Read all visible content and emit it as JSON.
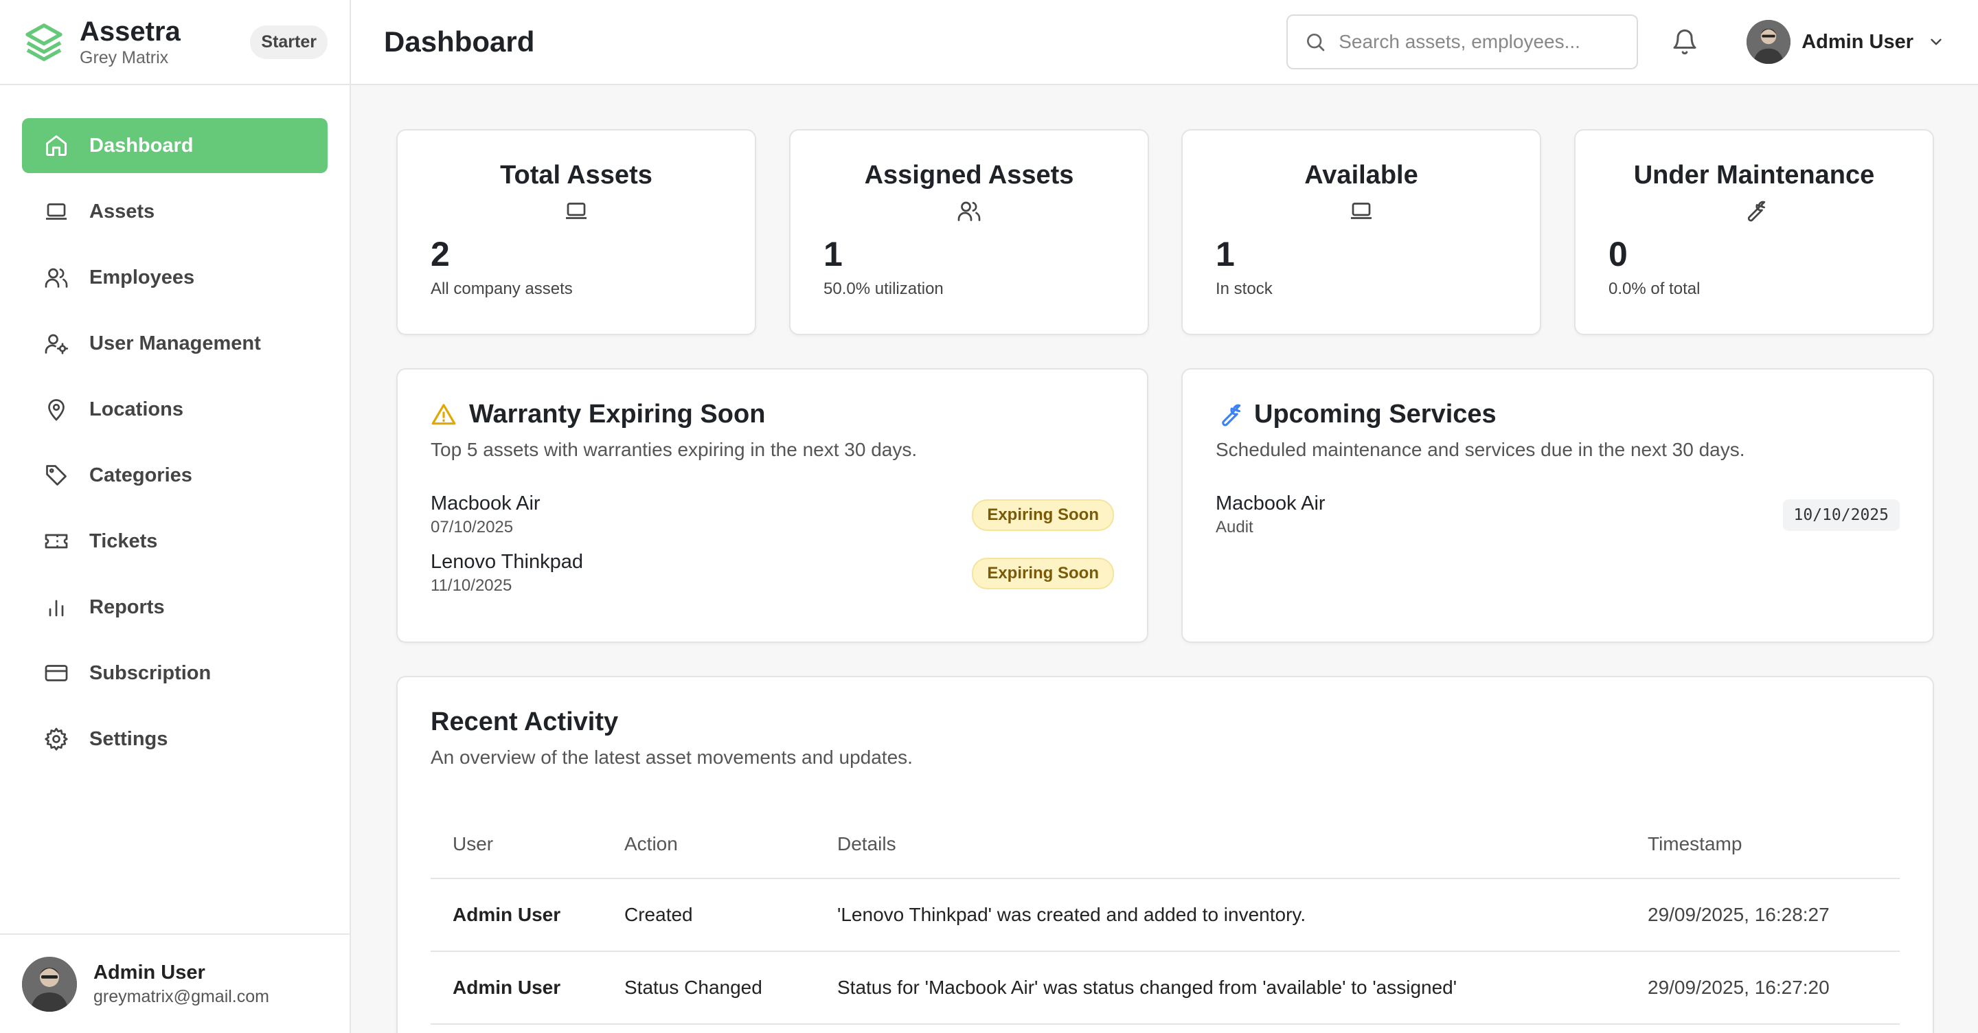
{
  "brand": {
    "name": "Assetra",
    "org": "Grey Matrix",
    "plan": "Starter"
  },
  "sidebar": {
    "items": [
      {
        "label": "Dashboard",
        "icon": "home-icon",
        "active": true
      },
      {
        "label": "Assets",
        "icon": "laptop-icon"
      },
      {
        "label": "Employees",
        "icon": "users-icon"
      },
      {
        "label": "User Management",
        "icon": "user-cog-icon"
      },
      {
        "label": "Locations",
        "icon": "map-pin-icon"
      },
      {
        "label": "Categories",
        "icon": "tag-icon"
      },
      {
        "label": "Tickets",
        "icon": "ticket-icon"
      },
      {
        "label": "Reports",
        "icon": "bar-chart-icon"
      },
      {
        "label": "Subscription",
        "icon": "credit-card-icon"
      },
      {
        "label": "Settings",
        "icon": "gear-icon"
      }
    ],
    "user": {
      "name": "Admin User",
      "email": "greymatrix@gmail.com"
    }
  },
  "header": {
    "title": "Dashboard",
    "search_placeholder": "Search assets, employees...",
    "user_name": "Admin User"
  },
  "stats": [
    {
      "title": "Total Assets",
      "value": "2",
      "sub": "All company assets",
      "icon": "laptop-icon"
    },
    {
      "title": "Assigned Assets",
      "value": "1",
      "sub": "50.0% utilization",
      "icon": "users-icon"
    },
    {
      "title": "Available",
      "value": "1",
      "sub": "In stock",
      "icon": "laptop-icon"
    },
    {
      "title": "Under Maintenance",
      "value": "0",
      "sub": "0.0% of total",
      "icon": "wrench-icon"
    }
  ],
  "warranty": {
    "title": "Warranty Expiring Soon",
    "sub": "Top 5 assets with warranties expiring in the next 30 days.",
    "items": [
      {
        "name": "Macbook Air",
        "date": "07/10/2025",
        "badge": "Expiring Soon"
      },
      {
        "name": "Lenovo Thinkpad",
        "date": "11/10/2025",
        "badge": "Expiring Soon"
      }
    ]
  },
  "services": {
    "title": "Upcoming Services",
    "sub": "Scheduled maintenance and services due in the next 30 days.",
    "items": [
      {
        "name": "Macbook Air",
        "type": "Audit",
        "date": "10/10/2025"
      }
    ]
  },
  "activity": {
    "title": "Recent Activity",
    "sub": "An overview of the latest asset movements and updates.",
    "columns": [
      "User",
      "Action",
      "Details",
      "Timestamp"
    ],
    "rows": [
      {
        "user": "Admin User",
        "action": "Created",
        "details": "'Lenovo Thinkpad' was created and added to inventory.",
        "timestamp": "29/09/2025, 16:28:27"
      },
      {
        "user": "Admin User",
        "action": "Status Changed",
        "details": "Status for 'Macbook Air' was status changed from 'available' to 'assigned'",
        "timestamp": "29/09/2025, 16:27:20"
      }
    ]
  },
  "colors": {
    "accent": "#66c97a",
    "warning": "#e0a800",
    "service_icon": "#3b82f6"
  }
}
